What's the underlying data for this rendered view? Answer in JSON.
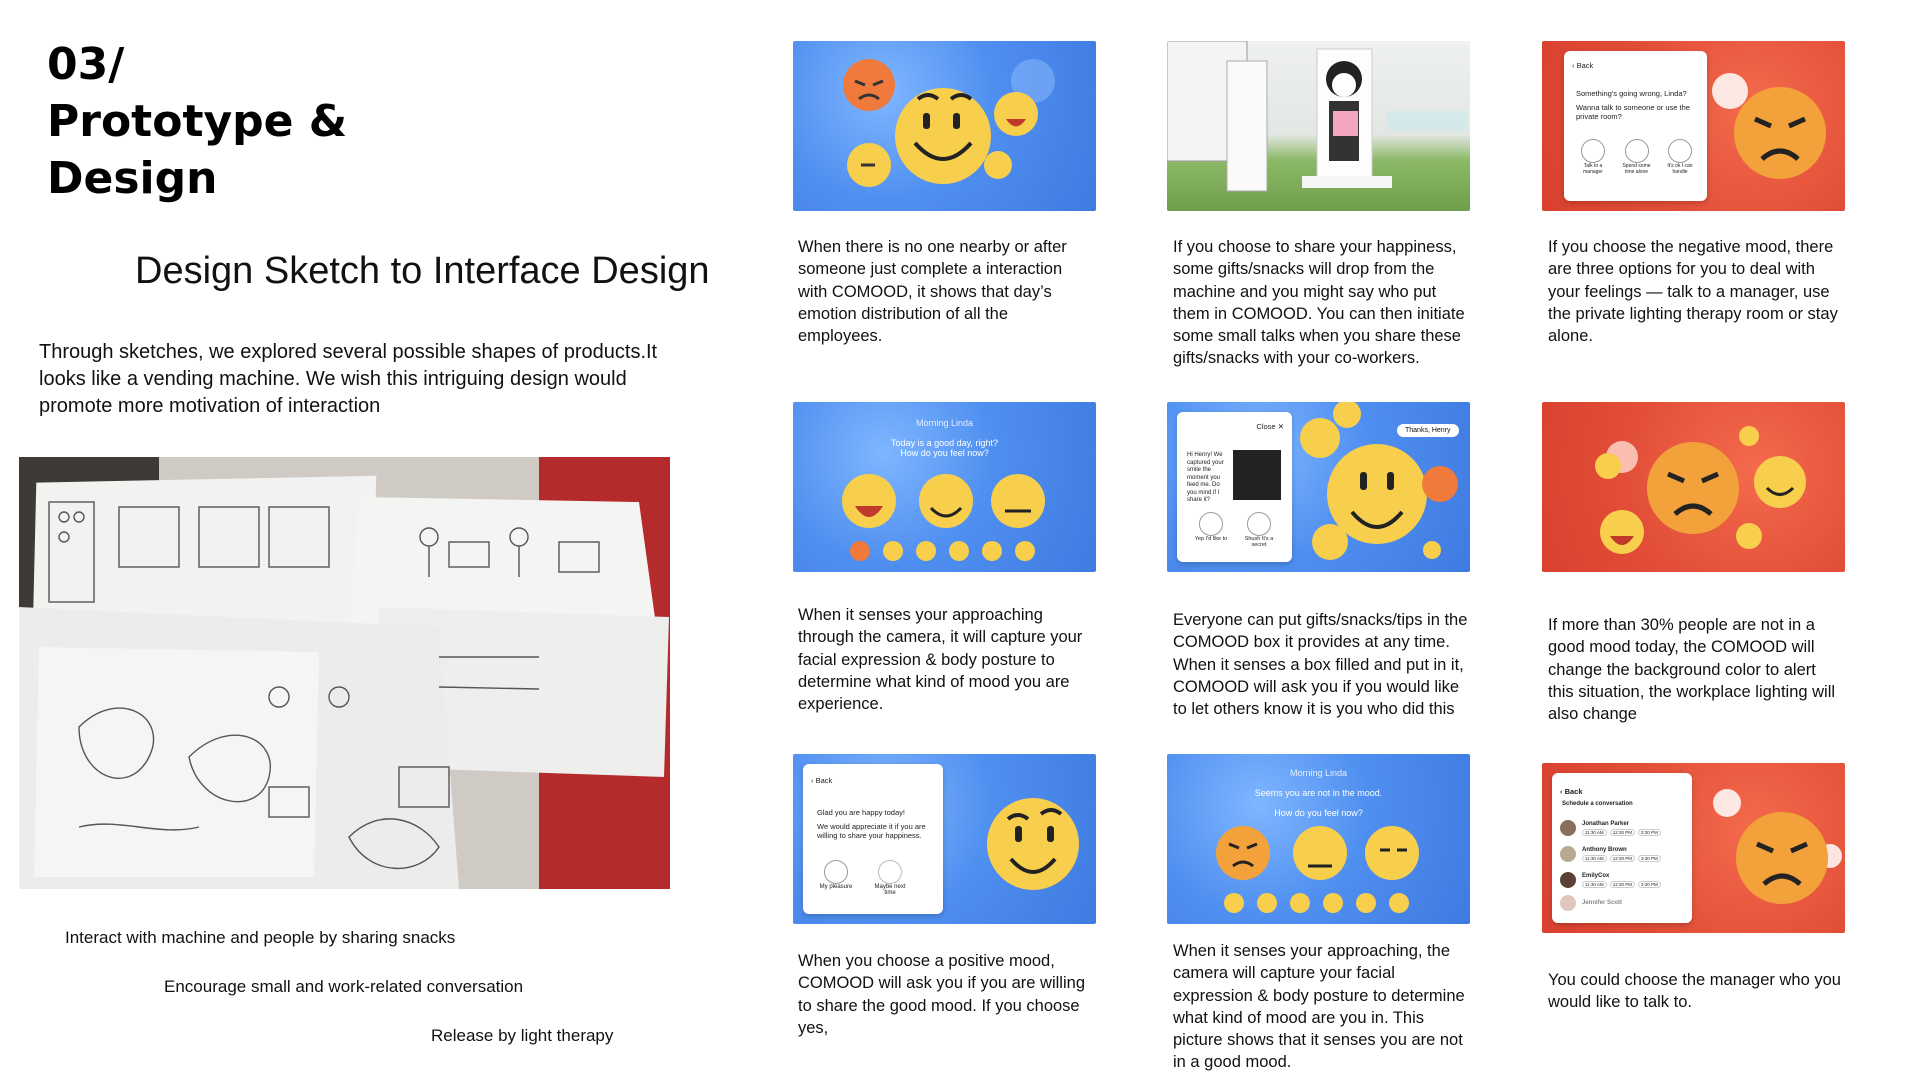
{
  "header": {
    "section_title": "03/\nPrototype &\nDesign",
    "subtitle": "Design Sketch to Interface Design"
  },
  "intro_text": "Through sketches, we explored several possible shapes of products.It looks like a vending machine. We wish this intriguing design would promote more motivation of interaction",
  "bullets": [
    "Interact with machine and people by sharing snacks",
    "Encourage small and work-related conversation",
    "Release by light therapy"
  ],
  "panels": [
    {
      "caption": "When there is no one nearby or after someone just complete a interaction with COMOOD, it shows that day’s emotion distribution of all the employees."
    },
    {
      "caption": "If you choose to share your happiness, some gifts/snacks will drop from the machine and you might say who put them in COMOOD. You can then initiate some small talks when you share these gifts/snacks with your co-workers."
    },
    {
      "caption": "If you choose the negative mood, there are three options for you to deal with your feelings — talk to a manager, use the private lighting therapy room or stay alone."
    },
    {
      "caption": "When it senses your approaching through the camera, it will capture your facial expression & body posture to determine what kind of mood you are experience."
    },
    {
      "caption": "Everyone can put gifts/snacks/tips in the COMOOD box it provides at any time. When it senses a box filled and put in it, COMOOD will ask you if you would like to let others know it is you who did this"
    },
    {
      "caption": "If more than 30% people are not in a good mood today, the COMOOD will change the background color to alert this situation, the workplace lighting will also change"
    },
    {
      "caption": "When you choose a positive mood, COMOOD will ask you if you are willing to share the good mood. If you choose yes,"
    },
    {
      "caption": "When it senses your approaching, the camera will capture your facial expression & body posture to determine what kind of mood are you in. This picture shows that it senses you are not in a good mood."
    },
    {
      "caption": "You could choose the manager who you would like to talk to."
    }
  ],
  "screens": {
    "negative_options": {
      "back": "Back",
      "question": "Something's going wrong, Linda?",
      "prompt": "Wanna talk to someone or use the private room?",
      "options": [
        "Talk to a manager",
        "Spend some time alone",
        "It's ok I can handle"
      ]
    },
    "morning_positive": {
      "greeting": "Morning Linda",
      "line1": "Today is a good day, right?",
      "line2": "How do you feel now?"
    },
    "gift_share": {
      "close": "Close",
      "message": "Hi Henry! We captured your smile the moment you feed me. Do you mind if I share it?",
      "yes": "Yep I'd like to",
      "no": "Shush It's a secret",
      "bubble": "Thanks, Henry"
    },
    "positive_share": {
      "back": "Back",
      "line1": "Glad you are happy today!",
      "line2": "We would appreciate it if you are willing to share your happiness.",
      "yes": "My pleasure",
      "no": "Maybe next time"
    },
    "morning_negative": {
      "greeting": "Morning Linda",
      "line1": "Seems you are not in the mood.",
      "line2": "How do you feel now?"
    },
    "managers": {
      "back": "Back",
      "heading": "Schedule a conversation",
      "people": [
        "Jonathan Parker",
        "Anthony Brown",
        "EmilyCox",
        "Jennifer Scott"
      ],
      "slots": [
        "11:30 AM",
        "12:30 PM",
        "3:30 PM"
      ]
    }
  },
  "colors": {
    "blue_screen": "#4f8ff0",
    "red_screen": "#e24e38",
    "emoji_yellow": "#f8cf4d"
  }
}
